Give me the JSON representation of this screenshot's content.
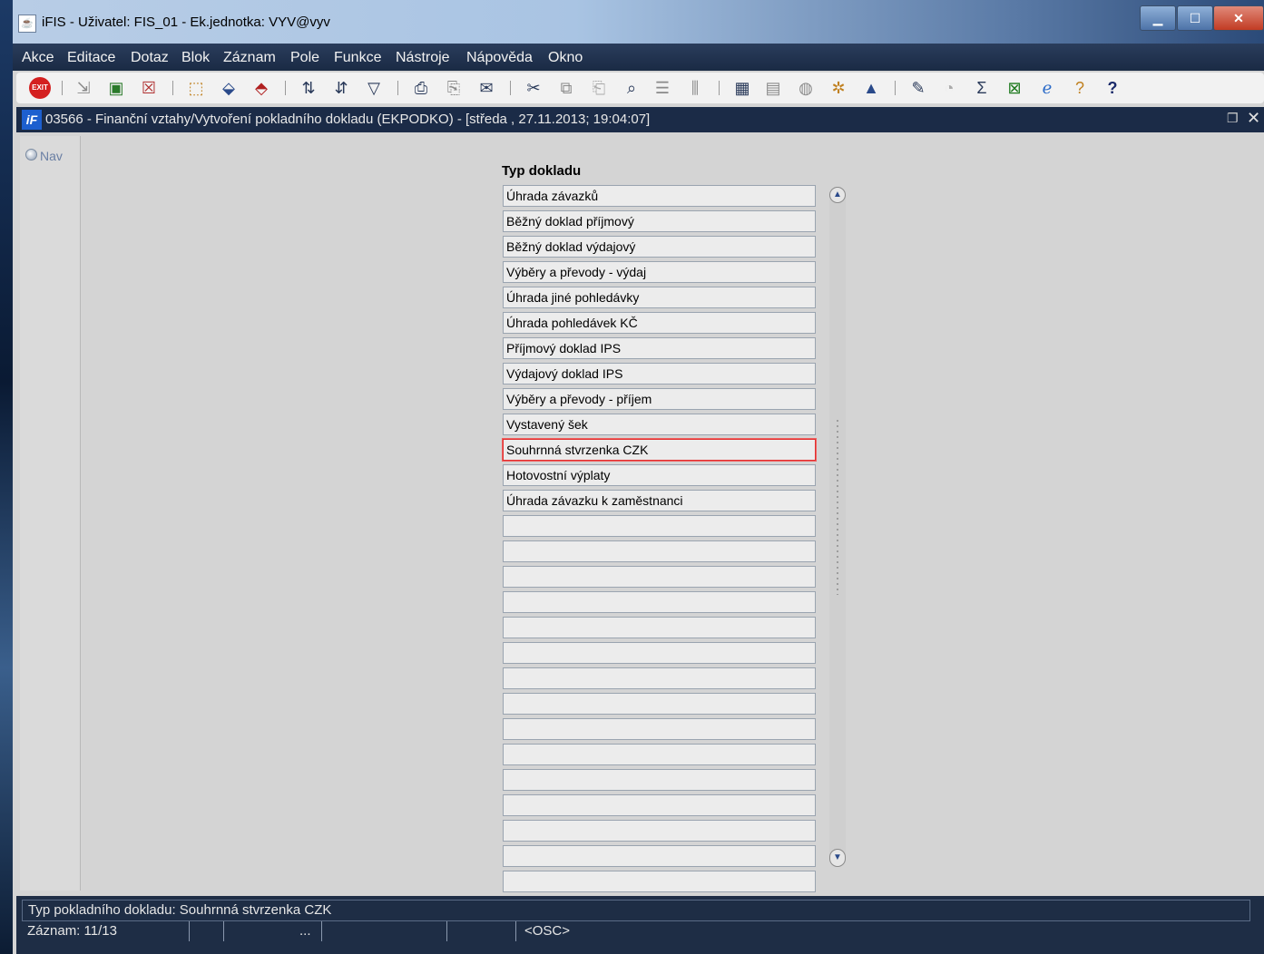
{
  "window": {
    "title": "iFIS - Uživatel: FIS_01 - Ek.jednotka: VYV@vyv",
    "controls": {
      "minimize": "▁",
      "maximize": "☐",
      "close": "✕"
    }
  },
  "menu": [
    "Akce",
    "Editace",
    "Dotaz",
    "Blok",
    "Záznam",
    "Pole",
    "Funkce",
    "Nástroje",
    "Nápověda",
    "Okno"
  ],
  "toolbar": {
    "exit_label": "EXIT",
    "icons": [
      "exit-icon",
      "save-icon",
      "insert-record-icon",
      "delete-record-icon",
      "query-icon",
      "execute-query-icon",
      "cancel-query-icon",
      "sort-asc-icon",
      "sort-desc-icon",
      "filter-icon",
      "print-icon",
      "print-preview-icon",
      "mail-icon",
      "cut-icon",
      "copy-icon",
      "paste-icon",
      "find-icon",
      "list-icon",
      "split-icon",
      "calculator-icon",
      "report-icon",
      "globe-icon",
      "gear-icon",
      "chart-icon",
      "notes-icon",
      "clock-icon",
      "sum-icon",
      "excel-icon",
      "ie-icon",
      "help-context-icon",
      "help-icon"
    ]
  },
  "form": {
    "title": "03566 - Finanční vztahy/Vytvoření pokladního dokladu (EKPODKO) - [středa , 27.11.2013; 19:04:07]",
    "icon_label": "iF"
  },
  "nav": {
    "label": "Nav"
  },
  "list": {
    "header": "Typ dokladu",
    "selected_index": 10,
    "items": [
      "Úhrada závazků",
      "Běžný doklad příjmový",
      "Běžný doklad výdajový",
      "Výběry a převody - výdaj",
      "Úhrada jiné pohledávky",
      "Úhrada pohledávek KČ",
      "Příjmový doklad IPS",
      "Výdajový doklad IPS",
      "Výběry a převody - příjem",
      "Vystavený šek",
      "Souhrnná stvrzenka CZK",
      "Hotovostní výplaty",
      "Úhrada závazku k zaměstnanci",
      "",
      "",
      "",
      "",
      "",
      "",
      "",
      "",
      "",
      "",
      "",
      "",
      "",
      "",
      "",
      "",
      ""
    ]
  },
  "status": {
    "message": "Typ pokladního dokladu: Souhrnná stvrzenka CZK",
    "record": "Záznam: 11/13",
    "ellipsis": "...",
    "mode": "<OSC>"
  }
}
